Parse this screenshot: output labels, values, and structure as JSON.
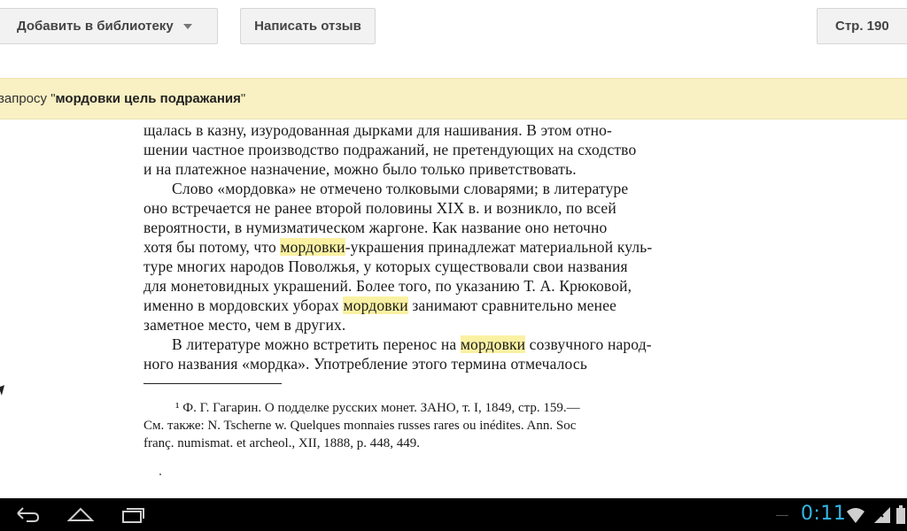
{
  "toolbar": {
    "add_to_library": "Добавить в библиотеку",
    "write_review": "Написать отзыв",
    "page_label": "Стр. 190"
  },
  "banner": {
    "prefix": "запросу \"",
    "query": "мордовки цель подражания",
    "suffix": "\""
  },
  "page_text": {
    "lines": [
      {
        "segments": [
          "щалась в казну, изуродованная дырками для нашивания. В этом отно-"
        ]
      },
      {
        "segments": [
          "шении частное производство подражаний, не претендующих на сходство"
        ]
      },
      {
        "segments": [
          "и на платежное назначение, можно было только приветствовать."
        ]
      },
      {
        "segments": [
          "Слово «мордовка» не отмечено толковыми словарями; в литературе"
        ]
      },
      {
        "segments": [
          "оно встречается не ранее второй половины XIX в. и возникло, по всей"
        ]
      },
      {
        "segments": [
          "вероятности, в нумизматическом жаргоне. Как название оно неточно"
        ]
      },
      {
        "segments": [
          "хотя бы потому, что ",
          "мордовки",
          "-украшения принадлежат материальной куль-"
        ]
      },
      {
        "segments": [
          "туре многих народов Поволжья, у которых существовали свои названия"
        ]
      },
      {
        "segments": [
          "для монетовидных украшений. Более того, по указанию Т. А. Крюковой,"
        ]
      },
      {
        "segments": [
          "именно в мордовских уборах ",
          "мордовки",
          " занимают сравнительно менее"
        ]
      },
      {
        "segments": [
          "заметное место, чем в других."
        ]
      },
      {
        "segments": [
          "В литературе можно встретить перенос на ",
          "мордовки",
          " созвучного народ-"
        ]
      },
      {
        "segments": [
          "ного названия «мордка». Употребление этого термина отмечалось"
        ]
      }
    ],
    "footnotes": [
      "¹ Ф. Г. Гагарин. О подделке русских монет. ЗАНО, т. I, 1849, стр. 159.—",
      "См. также: N. Tscherne w. Quelques monnaies russes rares ou inédites. Ann. Soc",
      "franç. numismat. et archeol., XII, 1888, p. 448, 449."
    ]
  },
  "status": {
    "time": "0:11"
  },
  "colors": {
    "highlight": "#fbf1a3",
    "banner_bg": "#f9f0c3",
    "clock": "#33b5e5"
  },
  "icons": [
    "caret-down-icon",
    "back-icon",
    "home-icon",
    "recent-apps-icon",
    "wifi-icon",
    "signal-icon"
  ]
}
